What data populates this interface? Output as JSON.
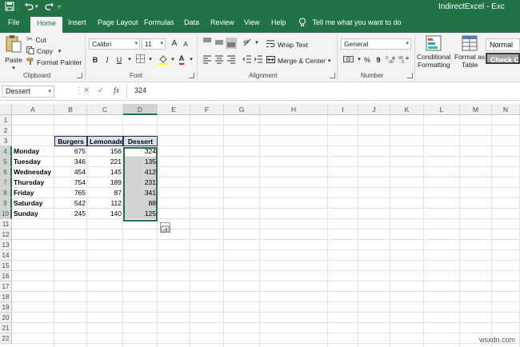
{
  "titlebar": {
    "title": "IndirectExcel - Exc",
    "icons": [
      "save-icon",
      "undo-icon",
      "redo-icon",
      "customize-icon"
    ]
  },
  "tabs": [
    "File",
    "Home",
    "Insert",
    "Page Layout",
    "Formulas",
    "Data",
    "Review",
    "View",
    "Help"
  ],
  "active_tab": "Home",
  "tell_me": "Tell me what you want to do",
  "ribbon": {
    "clipboard": {
      "label": "Clipboard",
      "paste": "Paste",
      "cut": "Cut",
      "copy": "Copy",
      "format_painter": "Format Painter"
    },
    "font": {
      "label": "Font",
      "font_name": "Calibri",
      "font_size": "11",
      "bold": "B",
      "italic": "I",
      "underline": "U",
      "grow": "A",
      "shrink": "A"
    },
    "alignment": {
      "label": "Alignment",
      "wrap_text": "Wrap Text",
      "merge_center": "Merge & Center"
    },
    "number": {
      "label": "Number",
      "format": "General",
      "currency": "$",
      "percent": "%",
      "comma": "9"
    },
    "styles": {
      "conditional_formatting_1": "Conditional",
      "conditional_formatting_2": "Formatting",
      "format_as_table_1": "Format as",
      "format_as_table_2": "Table",
      "style_normal": "Normal",
      "style_check_cell": "Check Cell"
    }
  },
  "formula_bar": {
    "name_box": "Dessert",
    "cancel_icon": "✕",
    "enter_icon": "✓",
    "fx": "fx",
    "value": "324"
  },
  "grid": {
    "columns": [
      "A",
      "B",
      "C",
      "D",
      "E",
      "F",
      "G",
      "H",
      "I",
      "J",
      "K",
      "L",
      "M",
      "N"
    ],
    "selected_column": "D",
    "rows": [
      "1",
      "2",
      "3",
      "4",
      "5",
      "6",
      "7",
      "8",
      "9",
      "10",
      "11",
      "12",
      "13",
      "14",
      "15",
      "16",
      "17",
      "18",
      "19",
      "20",
      "21",
      "22"
    ],
    "selected_rows": [
      "4",
      "5",
      "6",
      "7",
      "8",
      "9",
      "10"
    ],
    "table": {
      "headers": [
        "Burgers",
        "Lemonade",
        "Dessert"
      ],
      "days": [
        "Monday",
        "Tuesday",
        "Wednesday",
        "Thursday",
        "Friday",
        "Saturday",
        "Sunday"
      ],
      "burgers": [
        "675",
        "346",
        "454",
        "754",
        "765",
        "542",
        "245"
      ],
      "lemonade": [
        "156",
        "221",
        "145",
        "189",
        "87",
        "112",
        "140"
      ],
      "dessert": [
        "324",
        "135",
        "412",
        "231",
        "341",
        "88",
        "125"
      ]
    }
  },
  "watermark": "wsxdn.com"
}
